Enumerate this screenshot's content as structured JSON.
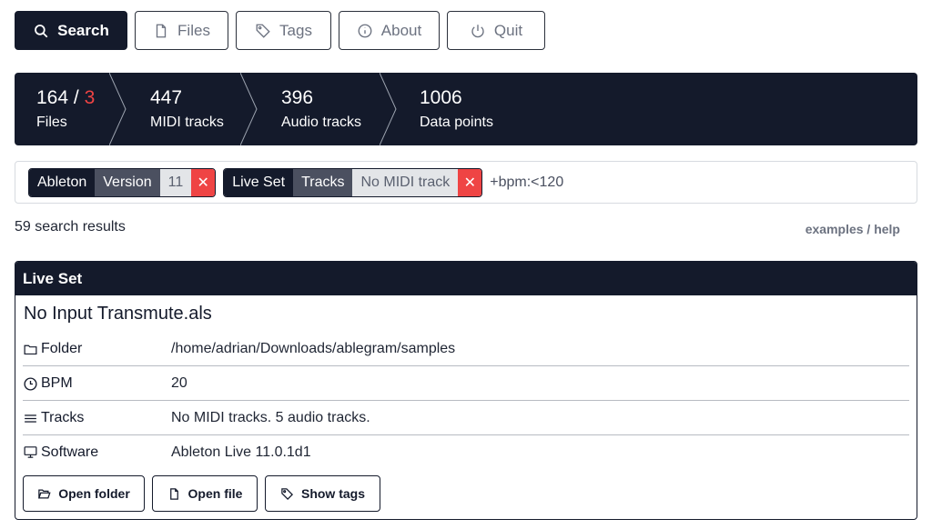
{
  "nav": {
    "search": "Search",
    "files": "Files",
    "tags": "Tags",
    "about": "About",
    "quit": "Quit"
  },
  "stats": {
    "files_count": "164",
    "files_sep": " / ",
    "files_alert": "3",
    "files_label": "Files",
    "midi_count": "447",
    "midi_label": "MIDI tracks",
    "audio_count": "396",
    "audio_label": "Audio tracks",
    "data_count": "1006",
    "data_label": "Data points"
  },
  "filters": {
    "tag1": {
      "category": "Ableton",
      "key": "Version",
      "value": "11"
    },
    "tag2": {
      "category": "Live Set",
      "key": "Tracks",
      "value": "No MIDI track"
    },
    "remove_glyph": "✕",
    "query": "+bpm:<120"
  },
  "results": {
    "count_text": "59 search results",
    "help_link": "examples / help"
  },
  "card": {
    "header": "Live Set",
    "title": "No Input Transmute.als",
    "folder_label": "Folder",
    "folder_value": "/home/adrian/Downloads/ablegram/samples",
    "bpm_label": "BPM",
    "bpm_value": "20",
    "tracks_label": "Tracks",
    "tracks_value": "No MIDI tracks. 5 audio tracks.",
    "software_label": "Software",
    "software_value": "Ableton Live 11.0.1d1",
    "open_folder": "Open folder",
    "open_file": "Open file",
    "show_tags": "Show tags"
  },
  "colors": {
    "primary": "#141a2b",
    "danger": "#ef4444"
  }
}
